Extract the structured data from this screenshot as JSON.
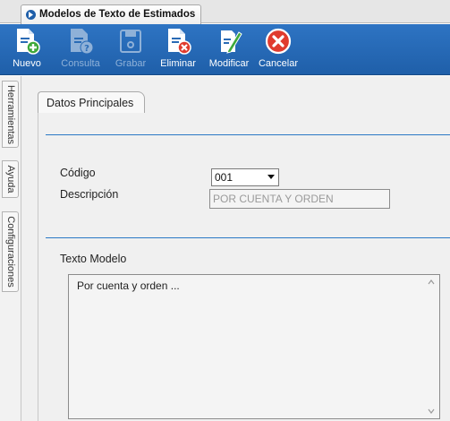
{
  "window": {
    "tab_title": "Modelos de Texto de Estimados"
  },
  "toolbar": {
    "buttons": [
      {
        "label": "Nuevo",
        "icon": "document-add-icon",
        "enabled": true
      },
      {
        "label": "Consulta",
        "icon": "document-query-icon",
        "enabled": false
      },
      {
        "label": "Grabar",
        "icon": "save-disk-icon",
        "enabled": false
      },
      {
        "label": "Eliminar",
        "icon": "document-delete-icon",
        "enabled": true
      },
      {
        "label": "Modificar",
        "icon": "document-edit-icon",
        "enabled": true
      },
      {
        "label": "Cancelar",
        "icon": "cancel-circle-icon",
        "enabled": true
      }
    ]
  },
  "sidebar": {
    "tabs": [
      {
        "label": "Herramientas"
      },
      {
        "label": "Ayuda"
      },
      {
        "label": "Configuraciones"
      }
    ]
  },
  "form": {
    "tab_label": "Datos Principales",
    "codigo_label": "Código",
    "codigo_value": "001",
    "descripcion_label": "Descripción",
    "descripcion_value": "POR CUENTA Y ORDEN",
    "texto_label": "Texto Modelo",
    "texto_value": "Por cuenta y orden ..."
  },
  "colors": {
    "toolbar_bg": "#2468b4",
    "separator": "#2b79c5",
    "cancel_red": "#e03b2e",
    "add_green": "#3fa83a"
  }
}
